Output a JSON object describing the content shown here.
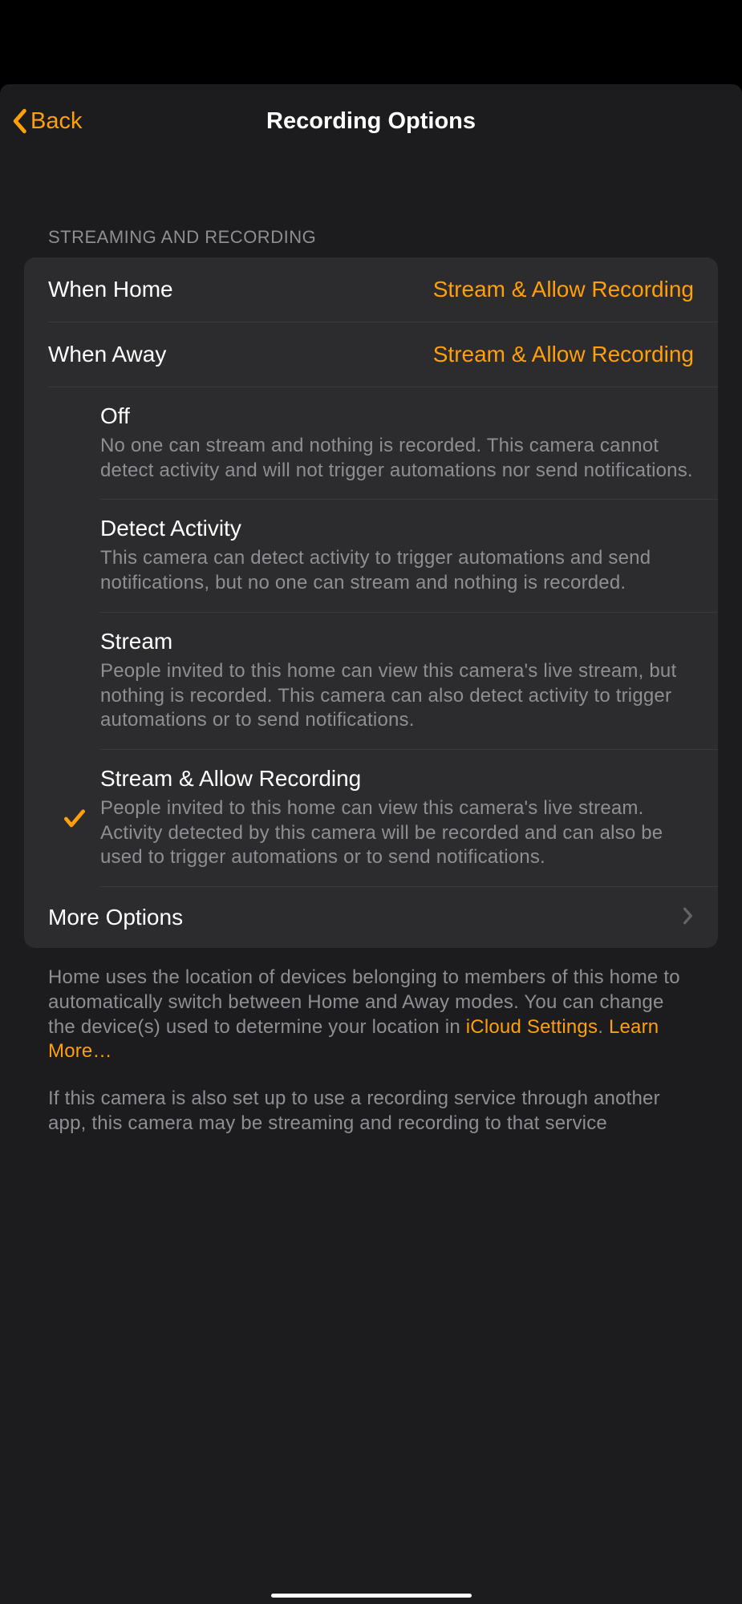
{
  "nav": {
    "back_label": "Back",
    "title": "Recording Options"
  },
  "section_header": "STREAMING AND RECORDING",
  "modes": {
    "home_label": "When Home",
    "home_value": "Stream & Allow Recording",
    "away_label": "When Away",
    "away_value": "Stream & Allow Recording"
  },
  "options": [
    {
      "title": "Off",
      "desc": "No one can stream and nothing is recorded. This camera cannot detect activity and will not trigger automations nor send notifications.",
      "selected": false
    },
    {
      "title": "Detect Activity",
      "desc": "This camera can detect activity to trigger automations and send notifications, but no one can stream and nothing is recorded.",
      "selected": false
    },
    {
      "title": "Stream",
      "desc": "People invited to this home can view this camera's live stream, but nothing is recorded. This camera can also detect activity to trigger automations or to send notifications.",
      "selected": false
    },
    {
      "title": "Stream & Allow Recording",
      "desc": "People invited to this home can view this camera's live stream. Activity detected by this camera will be recorded and can also be used to trigger automations or to send notifications.",
      "selected": true
    }
  ],
  "more_options_label": "More Options",
  "footer": {
    "text_part1": "Home uses the location of devices belonging to members of this home to automatically switch between Home and Away modes. You can change the device(s) used to determine your location in ",
    "link1": "iCloud Settings",
    "text_part2": ". ",
    "link2": "Learn More…",
    "text2": "If this camera is also set up to use a recording service through another app, this camera may be streaming and recording to that service"
  }
}
